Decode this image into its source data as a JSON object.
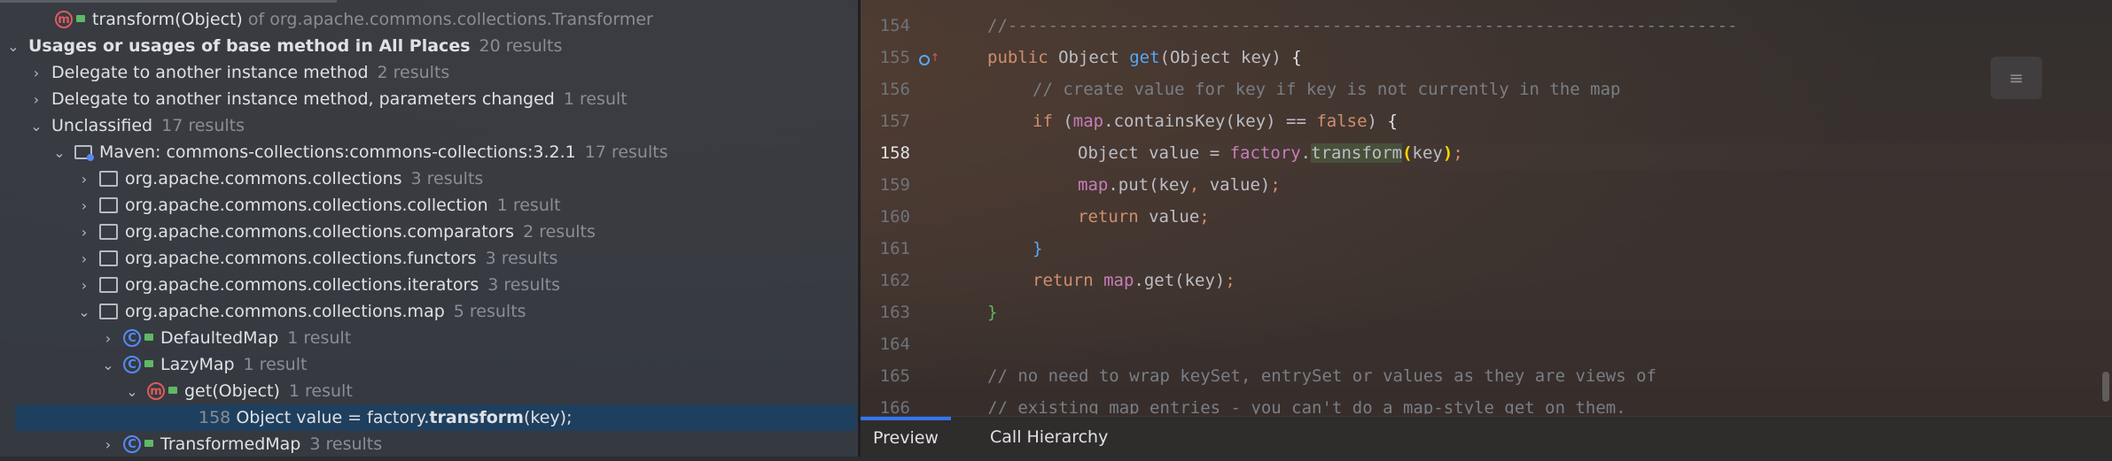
{
  "tree": {
    "header_method": {
      "name": "transform(Object)",
      "suffix": "of org.apache.commons.collections.Transformer"
    },
    "usages_group": {
      "label": "Usages or usages of base method in All Places",
      "count": "20 results"
    },
    "delegate1": {
      "label": "Delegate to another instance method",
      "count": "2 results"
    },
    "delegate2": {
      "label": "Delegate to another instance method, parameters changed",
      "count": "1 result"
    },
    "unclassified": {
      "label": "Unclassified",
      "count": "17 results"
    },
    "maven": {
      "label": "Maven: commons-collections:commons-collections:3.2.1",
      "count": "17 results"
    },
    "packages": [
      {
        "label": "org.apache.commons.collections",
        "count": "3 results"
      },
      {
        "label": "org.apache.commons.collections.collection",
        "count": "1 result"
      },
      {
        "label": "org.apache.commons.collections.comparators",
        "count": "2 results"
      },
      {
        "label": "org.apache.commons.collections.functors",
        "count": "3 results"
      },
      {
        "label": "org.apache.commons.collections.iterators",
        "count": "3 results"
      },
      {
        "label": "org.apache.commons.collections.map",
        "count": "5 results"
      }
    ],
    "defaulted_map": {
      "label": "DefaultedMap",
      "count": "1 result"
    },
    "lazy_map": {
      "label": "LazyMap",
      "count": "1 result"
    },
    "get_method": {
      "label": "get(Object)",
      "count": "1 result"
    },
    "usage_line": {
      "line": "158",
      "pre": "Object value = factory.",
      "match": "transform",
      "post": "(key);"
    },
    "transformed_map": {
      "label": "TransformedMap",
      "count": "3 results"
    },
    "icon_method": "m",
    "icon_class": "C"
  },
  "editor": {
    "line_numbers": [
      "154",
      "155",
      "156",
      "157",
      "158",
      "159",
      "160",
      "161",
      "162",
      "163",
      "164",
      "165",
      "166"
    ],
    "current_line": "158",
    "code": {
      "l154": "//------------------------------------------------------------------------",
      "l155_kw": "public",
      "l155_type": "Object",
      "l155_fn": "get",
      "l155_params": "(Object key)",
      "l155_brace": "{",
      "l156": "// create value for key if key is not currently in the map",
      "l157_kw": "if",
      "l157_open": "(",
      "l157_fld": "map",
      "l157_call": ".containsKey(key) == ",
      "l157_false": "false",
      "l157_close": ")",
      "l157_brace": "{",
      "l158_decl": "Object value = ",
      "l158_fld": "factory",
      "l158_dot": ".",
      "l158_fn": "transform",
      "l158_paren": "(",
      "l158_arg": "key",
      "l158_close": ")",
      "l158_semi": ";",
      "l159_fld": "map",
      "l159_rest": ".put(key",
      "l159_comma": ",",
      "l159_rest2": " value)",
      "l159_semi": ";",
      "l160_kw": "return",
      "l160_rest": " value",
      "l160_semi": ";",
      "l161": "}",
      "l162_kw": "return",
      "l162_fld": "map",
      "l162_rest": ".get(key)",
      "l162_semi": ";",
      "l163": "}",
      "l165": "// no need to wrap keySet, entrySet or values as they are views of",
      "l166": "// existing map entries - you can't do a map-style get on them."
    }
  },
  "tabs": [
    "Preview",
    "Call Hierarchy"
  ],
  "colors": {
    "selection": "#1f3f5e",
    "accent": "#3574f0",
    "keyword": "#cf8e6d",
    "field": "#c77dbb",
    "method_icon": "#db5c5c",
    "class_icon": "#548af7"
  }
}
